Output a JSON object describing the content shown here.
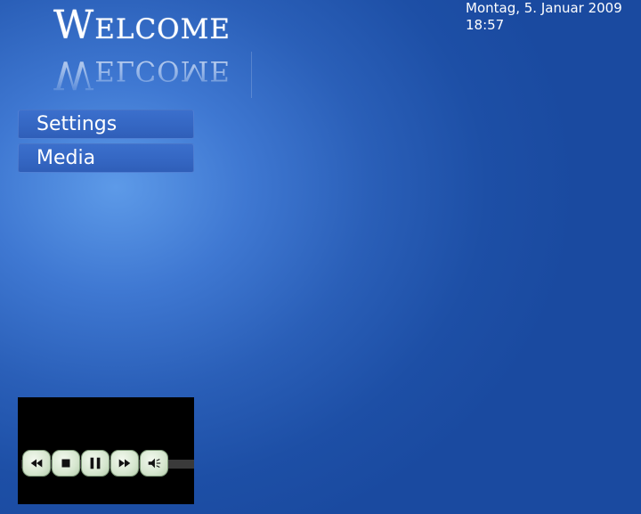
{
  "header": {
    "title": "Welcome",
    "reflection": "Welcome"
  },
  "clock": {
    "date": "Montag, 5. Januar 2009",
    "time": "18:57"
  },
  "menu": {
    "items": [
      {
        "label": "Settings"
      },
      {
        "label": "Media"
      }
    ]
  },
  "player": {
    "controls": [
      {
        "icon": "rewind-icon"
      },
      {
        "icon": "stop-icon"
      },
      {
        "icon": "pause-icon"
      },
      {
        "icon": "fast-forward-icon"
      },
      {
        "icon": "volume-icon"
      }
    ]
  },
  "colors": {
    "background": "#1a4aa0",
    "menu_item": "#3466c2",
    "player_background": "#000000",
    "control_button": "#d6e6cf"
  }
}
